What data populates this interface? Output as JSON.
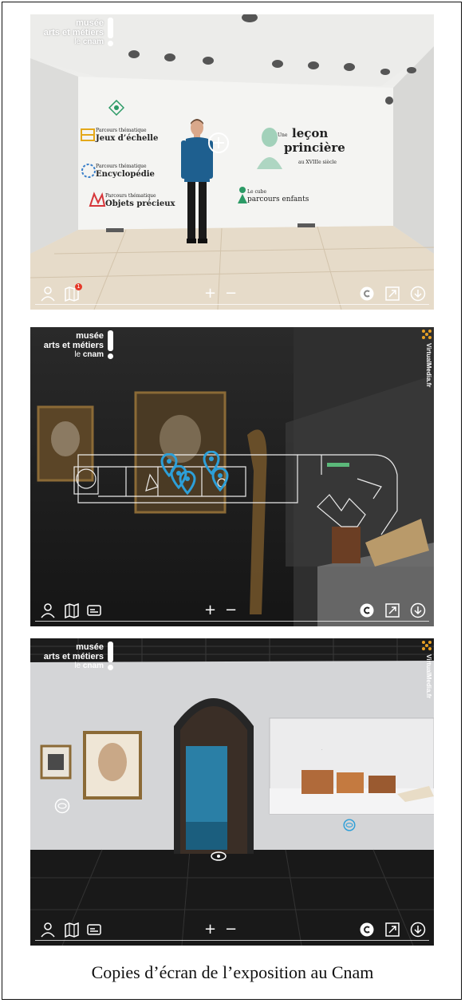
{
  "caption": "Copies d’écran de l’exposition au Cnam",
  "logo": {
    "line1": "musée",
    "line2_prefix": "",
    "line2_bold": "arts et métiers",
    "line3_prefix": "le ",
    "line3_bold": "cnam"
  },
  "panel1": {
    "wall_labels": [
      {
        "small": "Parcours thématique",
        "big": "Jeux d’échelle"
      },
      {
        "small": "Parcours thématique",
        "big": "Encyclopédie"
      },
      {
        "small": "Parcours thématique",
        "big": "Objets précieux"
      },
      {
        "small": "Une",
        "big": "leçon"
      },
      {
        "small": "",
        "big": "princière"
      },
      {
        "small": "",
        "big": "au XVIIIe siècle"
      },
      {
        "small": "Le cube",
        "big": "parcours enfants"
      }
    ],
    "map_badge_count": "1"
  },
  "toolbar": {
    "zoom_in": "+",
    "zoom_out": "−",
    "copyright": "©"
  },
  "brand": {
    "virtualmedia": "VirtualMedia.fr"
  },
  "colors": {
    "hotspot_blue": "#2d9fd8",
    "badge_red": "#e53a2a",
    "wall_green": "#2c9a66"
  }
}
